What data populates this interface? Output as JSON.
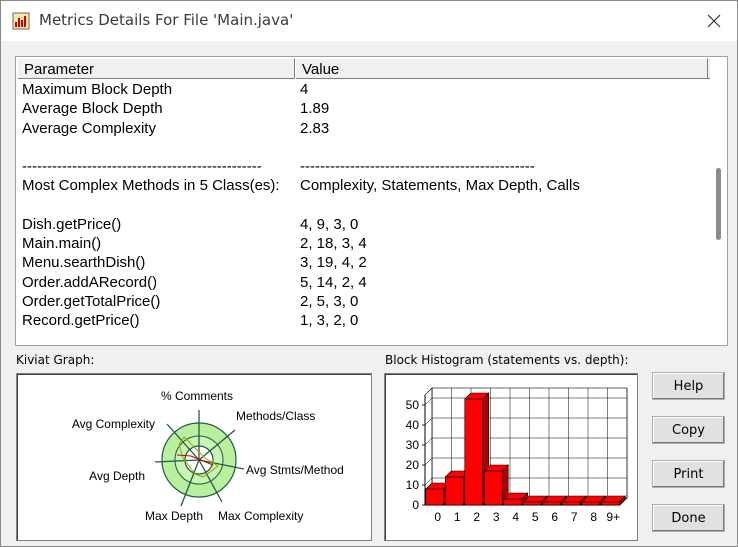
{
  "window": {
    "title": "Metrics Details For File 'Main.java'"
  },
  "table": {
    "headers": {
      "parameter": "Parameter",
      "value": "Value"
    },
    "rows": [
      {
        "param": "Maximum Block Depth",
        "value": "4"
      },
      {
        "param": "Average Block Depth",
        "value": "1.89"
      },
      {
        "param": "Average Complexity",
        "value": "2.83"
      },
      {
        "param": "",
        "value": ""
      },
      {
        "param": "------------------------------------------------",
        "value": "-----------------------------------------------"
      },
      {
        "param": "Most Complex Methods in 5 Class(es):",
        "value": "Complexity, Statements, Max Depth, Calls"
      },
      {
        "param": "",
        "value": ""
      },
      {
        "param": "Dish.getPrice()",
        "value": "4, 9, 3, 0"
      },
      {
        "param": "Main.main()",
        "value": "2, 18, 3, 4"
      },
      {
        "param": "Menu.searthDish()",
        "value": "3, 19, 4, 2"
      },
      {
        "param": "Order.addARecord()",
        "value": "5, 14, 2, 4"
      },
      {
        "param": "Order.getTotalPrice()",
        "value": "2, 5, 3, 0"
      },
      {
        "param": "Record.getPrice()",
        "value": "1, 3, 2, 0"
      }
    ]
  },
  "kiviat": {
    "label": "Kiviat Graph:",
    "axes": [
      "% Comments",
      "Methods/Class",
      "Avg Stmts/Method",
      "Max Complexity",
      "Max Depth",
      "Avg Depth",
      "Avg Complexity"
    ]
  },
  "histogram": {
    "label": "Block Histogram (statements vs. depth):",
    "bar_color": "#ff0000"
  },
  "chart_data": {
    "type": "bar",
    "categories": [
      "0",
      "1",
      "2",
      "3",
      "4",
      "5",
      "6",
      "7",
      "8",
      "9+"
    ],
    "values": [
      8,
      14,
      53,
      17,
      3,
      0,
      0,
      0,
      0,
      0
    ],
    "yticks": [
      "0",
      "10",
      "20",
      "30",
      "40",
      "50"
    ],
    "ylim": [
      0,
      55
    ],
    "grid": true
  },
  "buttons": {
    "help": "Help",
    "copy": "Copy",
    "print": "Print",
    "done": "Done"
  }
}
